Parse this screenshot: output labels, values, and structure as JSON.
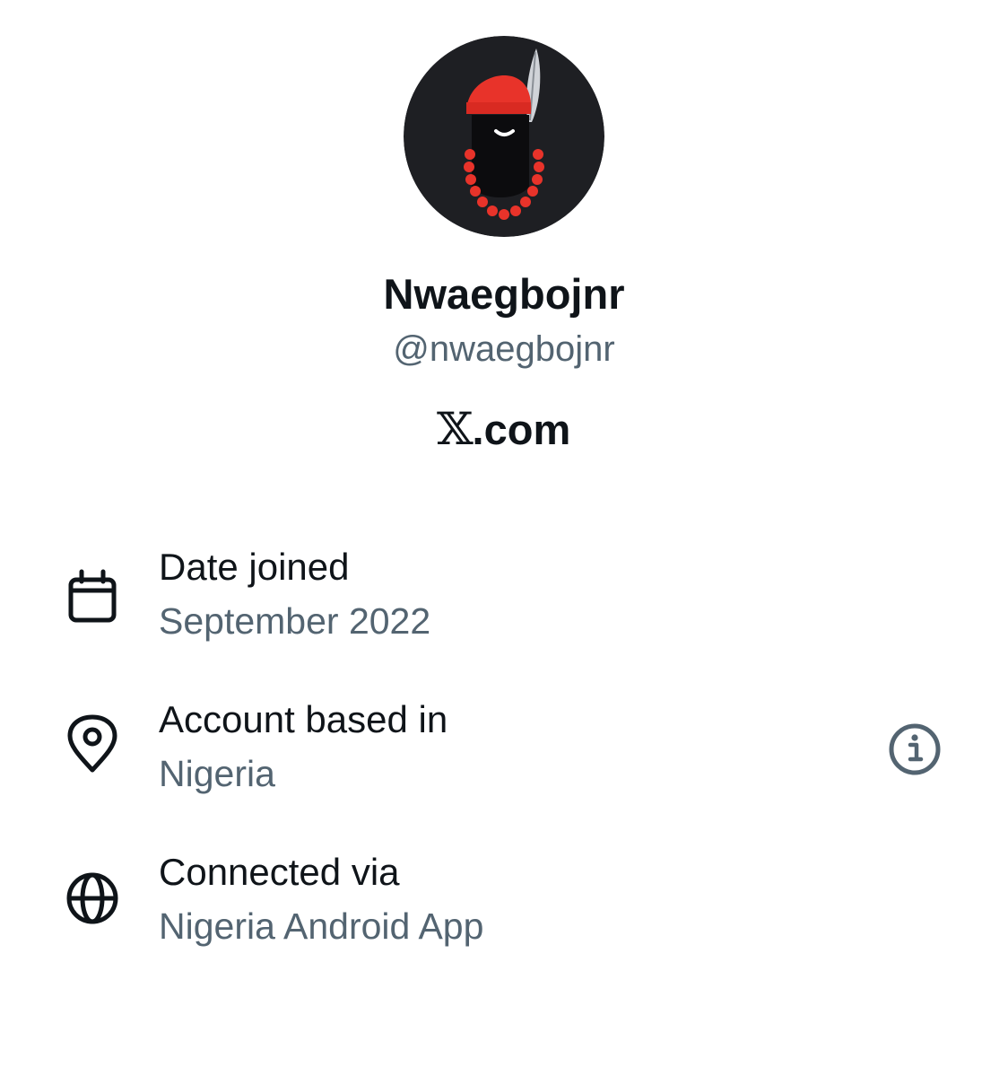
{
  "profile": {
    "display_name": "Nwaegbojnr",
    "handle": "@nwaegbojnr",
    "site_mark": "𝕏",
    "site_suffix": ".com"
  },
  "details": [
    {
      "label": "Date joined",
      "value": "September 2022",
      "icon": "calendar-icon"
    },
    {
      "label": "Account based in",
      "value": "Nigeria",
      "icon": "location-pin-icon"
    },
    {
      "label": "Connected via",
      "value": "Nigeria Android App",
      "icon": "globe-icon"
    }
  ],
  "icons": {
    "info": "info-icon"
  },
  "colors": {
    "primary_text": "#0f1419",
    "secondary_text": "#536471",
    "avatar_background": "#1e1f23",
    "avatar_accent": "#e8332a"
  }
}
